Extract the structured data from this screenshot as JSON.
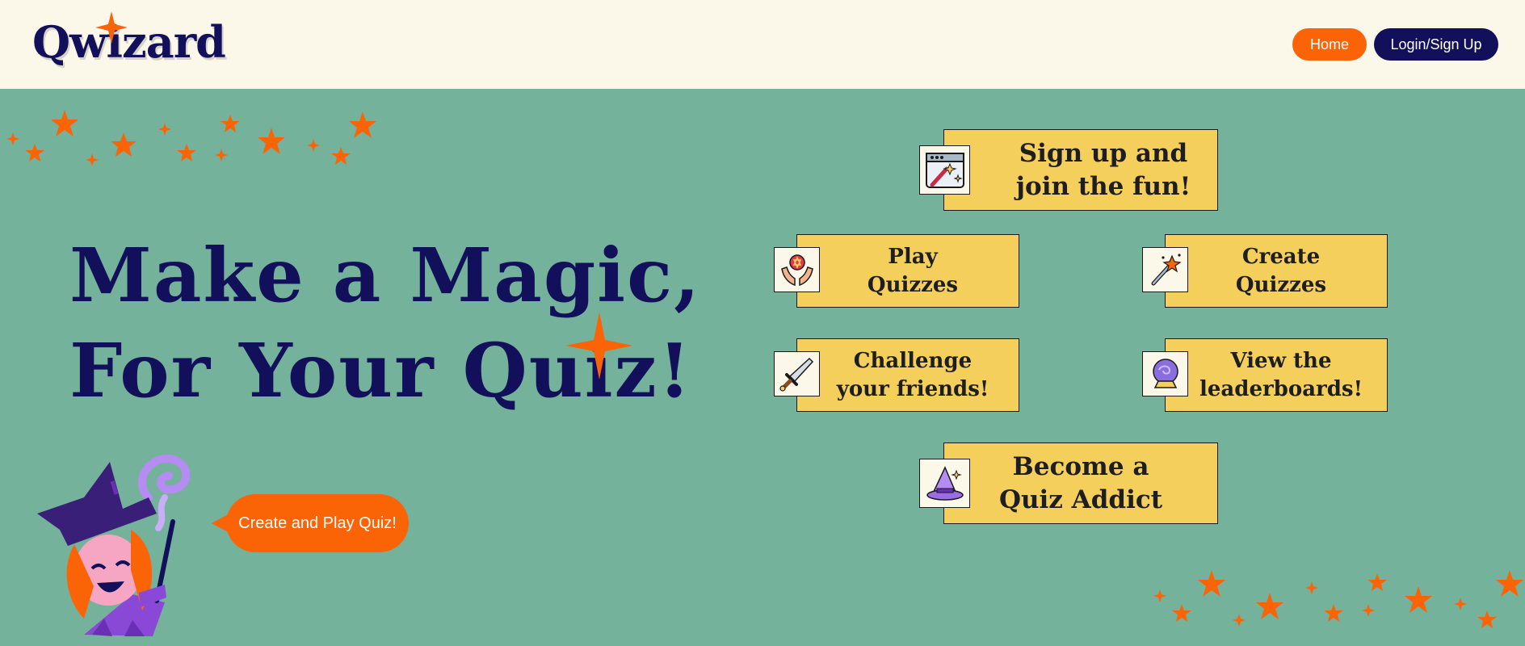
{
  "app": {
    "logo_text": "Qwizard"
  },
  "nav": {
    "home_label": "Home",
    "login_label": "Login/Sign Up"
  },
  "hero": {
    "line1": "Make a Magic,",
    "line2": "For Your Quiz!"
  },
  "cta": {
    "label": "Create and Play Quiz!"
  },
  "features": {
    "signup": {
      "label": "Sign up and\njoin the fun!",
      "icon": "magic-window-icon"
    },
    "play": {
      "label": "Play\nQuizzes",
      "icon": "hands-crystal-icon"
    },
    "create": {
      "label": "Create\nQuizzes",
      "icon": "magic-wand-icon"
    },
    "challenge": {
      "label": "Challenge\nyour friends!",
      "icon": "sword-icon"
    },
    "leaderboard": {
      "label": "View the\nleaderboards!",
      "icon": "crystal-ball-icon"
    },
    "addict": {
      "label": "Become a\nQuiz Addict",
      "icon": "witch-hat-icon"
    }
  },
  "colors": {
    "header_bg": "#fbf8ea",
    "page_bg": "#75b29b",
    "navy": "#12105a",
    "orange": "#fa6407",
    "card_yellow": "#f5cf5c"
  }
}
